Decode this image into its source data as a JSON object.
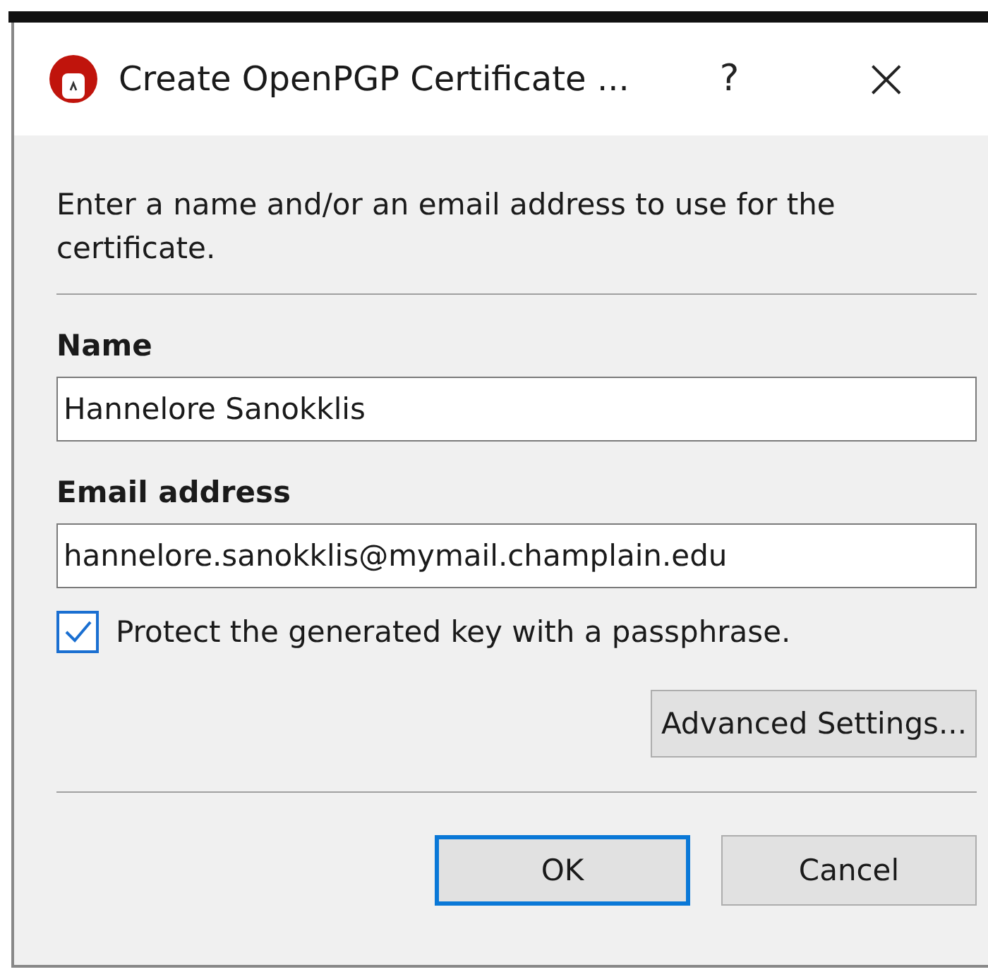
{
  "window": {
    "title": "Create OpenPGP Certificate ...",
    "help": "?",
    "close": "×"
  },
  "intro": "Enter a name and/or an email address to use for the certificate.",
  "fields": [
    {
      "label": "Name",
      "value": "Hannelore Sanokklis"
    },
    {
      "label": "Email address",
      "value": "hannelore.sanokklis@mymail.champlain.edu"
    }
  ],
  "passphrase": {
    "label": "Protect the generated key with a passphrase.",
    "checked": true
  },
  "advanced_button": "Advanced Settings...",
  "buttons": [
    {
      "label": "OK",
      "focused": true
    },
    {
      "label": "Cancel",
      "focused": false
    }
  ]
}
